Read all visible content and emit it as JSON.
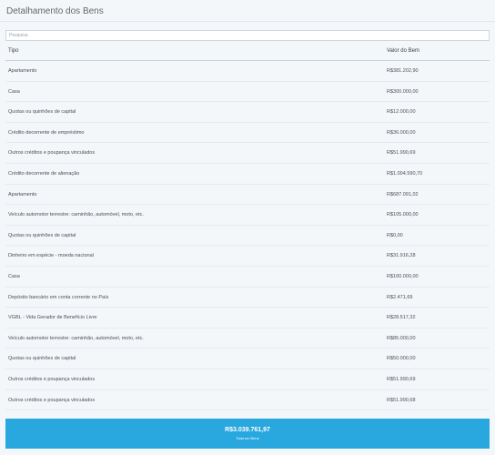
{
  "header": {
    "title": "Detalhamento dos Bens"
  },
  "search": {
    "placeholder": "Pesquisa",
    "value": ""
  },
  "table": {
    "columns": {
      "tipo": "Tipo",
      "valor": "Valor do Bem"
    },
    "rows": [
      {
        "tipo": "Apartamento",
        "valor": "R$381.202,90"
      },
      {
        "tipo": "Casa",
        "valor": "R$300.000,00"
      },
      {
        "tipo": "Quotas ou quinhões de capital",
        "valor": "R$12.000,00"
      },
      {
        "tipo": "Crédito decorrente de empréstimo",
        "valor": "R$36.000,00"
      },
      {
        "tipo": "Outros créditos e poupança vinculados",
        "valor": "R$51.990,69"
      },
      {
        "tipo": "Crédito decorrente de alienação",
        "valor": "R$1.004.590,70"
      },
      {
        "tipo": "Apartamento",
        "valor": "R$687.091,02"
      },
      {
        "tipo": "Veículo automotor terrestre: caminhão, automóvel, moto, etc.",
        "valor": "R$105.000,00"
      },
      {
        "tipo": "Quotas ou quinhões de capital",
        "valor": "R$0,00"
      },
      {
        "tipo": "Dinheiro em espécie - moeda nacional",
        "valor": "R$31.916,28"
      },
      {
        "tipo": "Casa",
        "valor": "R$160.000,00"
      },
      {
        "tipo": "Depósito bancário em conta corrente no País",
        "valor": "R$2.471,69"
      },
      {
        "tipo": "VGBL - Vida Gerador de Benefício Livre",
        "valor": "R$28.517,32"
      },
      {
        "tipo": "Veículo automotor terrestre: caminhão, automóvel, moto, etc.",
        "valor": "R$85.000,00"
      },
      {
        "tipo": "Quotas ou quinhões de capital",
        "valor": "R$50.000,00"
      },
      {
        "tipo": "Outros créditos e poupança vinculados",
        "valor": "R$51.990,69"
      },
      {
        "tipo": "Outros créditos e poupança vinculados",
        "valor": "R$51.990,68"
      }
    ]
  },
  "total": {
    "value": "R$3.039.761,97",
    "label": "Total em Bens"
  },
  "colors": {
    "accent": "#29a7df",
    "background": "#f4f7fa"
  }
}
